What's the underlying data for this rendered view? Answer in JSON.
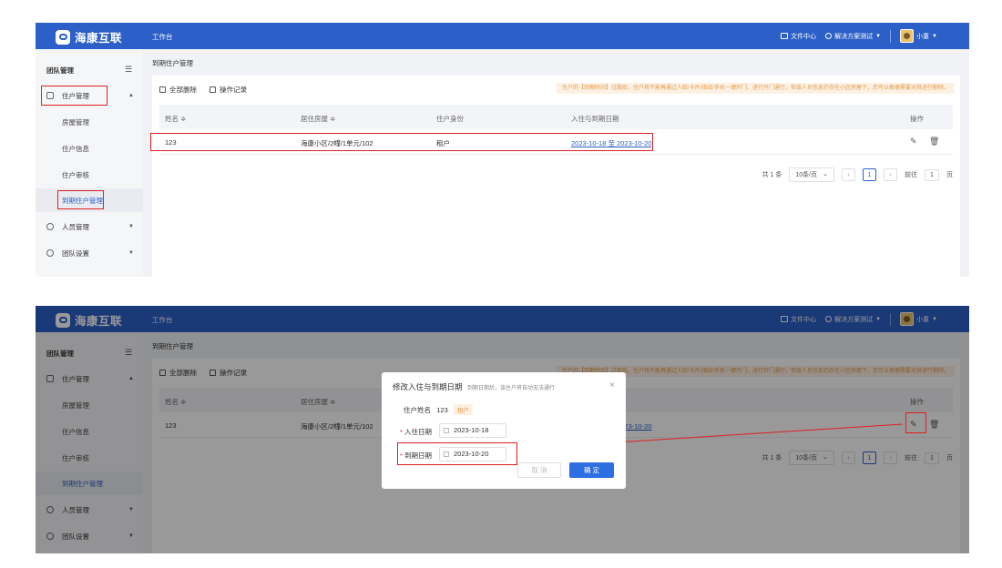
{
  "app": {
    "brand": "海康互联",
    "workbench": "工作台",
    "file_center": "文件中心",
    "solution": "解决方案测试",
    "user": "小童"
  },
  "sidebar": {
    "title": "团队管理",
    "groups": [
      {
        "label": "住户管理"
      },
      {
        "label": "人员管理"
      },
      {
        "label": "团队设置"
      }
    ],
    "sub_items": [
      "房屋管理",
      "住户信息",
      "住户审核",
      "到期住户管理"
    ]
  },
  "page": {
    "breadcrumb": "到期住户管理",
    "toolbar": {
      "delete_all": "全部删除",
      "op_log": "操作记录"
    },
    "notice": "住户的【到期时间】过期后，住户将不能再通过人脸/卡片/指纹/手机一键开门、进行开门通行，但该人员信息仍存在小区房屋下，您可以根据需要对其进行删除。",
    "columns": [
      "姓名 ≑",
      "居住房屋 ≑",
      "住户身份",
      "入住与到期日期",
      "操作"
    ],
    "rows": [
      {
        "name": "123",
        "house": "海康小区/2幢/1单元/102",
        "role": "租户",
        "start": "2023-10-18",
        "sep": "至",
        "end": "2023-10-20"
      }
    ],
    "pager": {
      "total": "共 1 条",
      "size": "10条/页",
      "current": "1",
      "goto": "前往",
      "goto_value": "1",
      "page_unit": "页"
    }
  },
  "dialog": {
    "title": "修改入住与到期日期",
    "hint": "到期日期后，该住户将自动无法通行",
    "name_label": "住户姓名",
    "name_value": "123",
    "role_tag": "租户",
    "checkin_label": "入住日期",
    "checkin_value": "2023-10-18",
    "expire_label": "到期日期",
    "expire_value": "2023-10-20",
    "cancel": "取 消",
    "confirm": "确 定"
  },
  "colors": {
    "header": "#2c5fc7",
    "highlight": "#e02020",
    "primary": "#2c6fe0"
  }
}
